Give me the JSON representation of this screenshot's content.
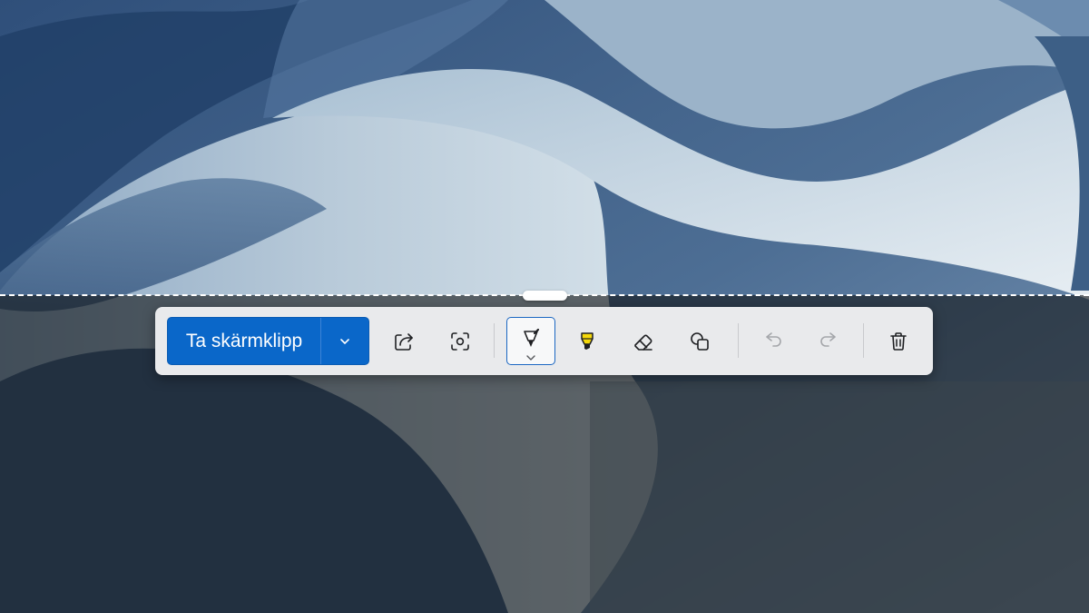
{
  "toolbar": {
    "capture_button": {
      "label": "Ta skärmklipp"
    },
    "capture_dropdown": {
      "icon": "chevron-down-icon"
    },
    "tools": [
      {
        "id": "share",
        "icon": "share-icon",
        "state": "enabled"
      },
      {
        "id": "visual-search",
        "icon": "visual-search-icon",
        "state": "enabled"
      },
      {
        "id": "ballpoint-pen",
        "icon": "ballpoint-pen-icon",
        "state": "selected",
        "has_submenu": true
      },
      {
        "id": "highlighter",
        "icon": "highlighter-icon",
        "state": "enabled",
        "color": "#f5d90a"
      },
      {
        "id": "eraser",
        "icon": "eraser-icon",
        "state": "enabled"
      },
      {
        "id": "shapes",
        "icon": "shapes-icon",
        "state": "enabled"
      },
      {
        "id": "undo",
        "icon": "undo-icon",
        "state": "disabled"
      },
      {
        "id": "redo",
        "icon": "redo-icon",
        "state": "disabled"
      },
      {
        "id": "delete",
        "icon": "trash-icon",
        "state": "enabled"
      }
    ]
  },
  "colors": {
    "accent": "#0a67c9",
    "selected_border": "#1b67c2",
    "highlighter": "#f5d90a",
    "disabled_icon": "#a4a6aa",
    "icon": "#1e1f22"
  }
}
